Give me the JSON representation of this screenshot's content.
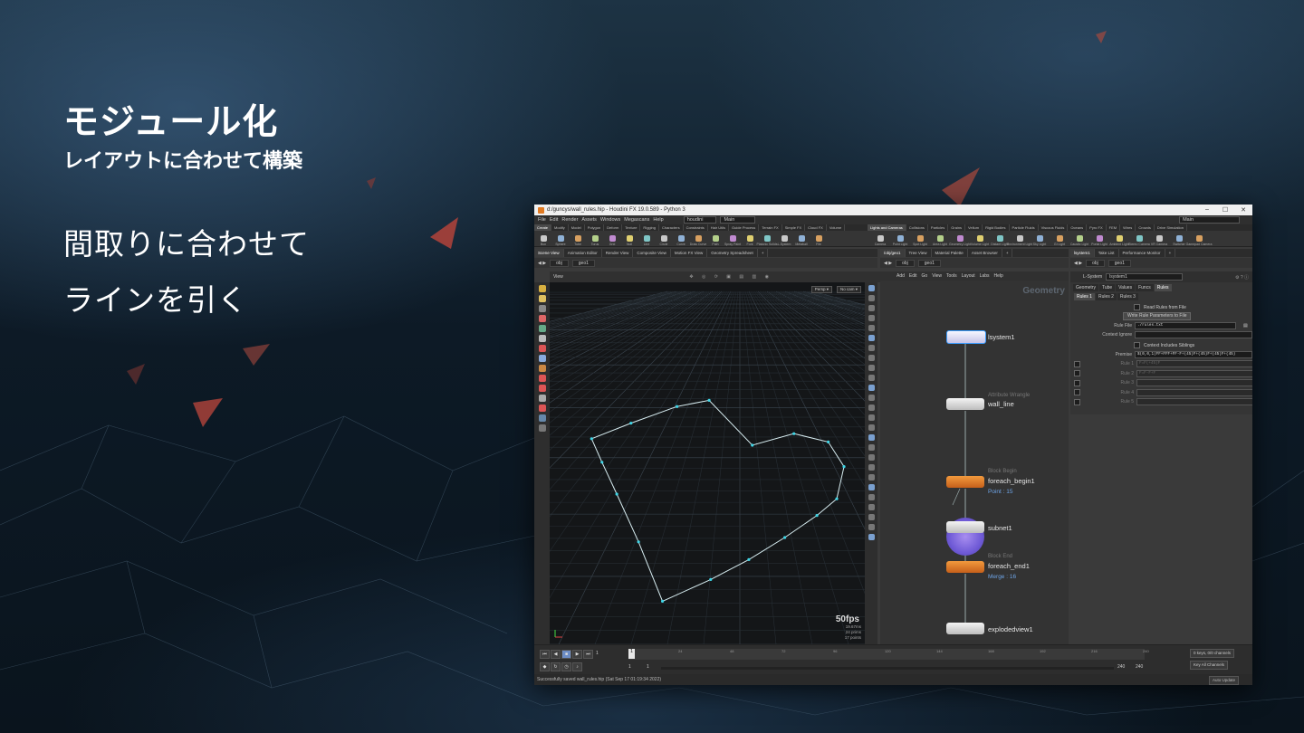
{
  "slide": {
    "title": "モジュール化",
    "subtitle": "レイアウトに合わせて構築",
    "body_line1": "間取りに合わせて",
    "body_line2": "ラインを引く"
  },
  "window": {
    "title": "d:/guncys/wall_rules.hip - Houdini FX 19.0.589 - Python 3",
    "controls": [
      "–",
      "☐",
      "✕"
    ]
  },
  "menu": {
    "items": [
      "File",
      "Edit",
      "Render",
      "Assets",
      "Windows",
      "Megascans",
      "Help"
    ],
    "desktop": "houdini",
    "main": "Main",
    "desktop_right": "Main"
  },
  "shelf_tabs_left": [
    "Create",
    "Modify",
    "Model",
    "Polygon",
    "Deform",
    "Texture",
    "Rigging",
    "Characters",
    "Constraints",
    "Hair Utils",
    "Guide Process",
    "Terrain FX",
    "Simple FX",
    "Cloud FX",
    "Volume"
  ],
  "shelf_tabs_right": [
    "Lights and Cameras",
    "Collisions",
    "Particles",
    "Grains",
    "Vellum",
    "Rigid Bodies",
    "Particle Fluids",
    "Viscous Fluids",
    "Oceans",
    "Pyro FX",
    "FEM",
    "Wires",
    "Crowds",
    "Drive Simulation"
  ],
  "shelf_tools_left": [
    "Box",
    "Sphere",
    "Tube",
    "Torus",
    "Grid",
    "Null",
    "Line",
    "Circle",
    "Curve",
    "Draw Curve",
    "Path",
    "Spray Paint",
    "Font",
    "Platonic Solids",
    "L-System",
    "Metaball",
    "File"
  ],
  "shelf_tools_right": [
    "Camera",
    "Point Light",
    "Spot Light",
    "Area Light",
    "Geometry Light",
    "Volume Light",
    "Distant Light",
    "Environment Light",
    "Sky Light",
    "GI Light",
    "Caustic Light",
    "Portal Light",
    "Ambient Light",
    "Stereo Camera",
    "VR Camera",
    "Switcher",
    "Gamepad Camera"
  ],
  "pane_tabs_left": [
    "Scene View",
    "Animation Editor",
    "Render View",
    "Composite View",
    "Motion FX View",
    "Geometry Spreadsheet"
  ],
  "pane_tabs_mid": [
    "/obj/geo1",
    "Tree View",
    "Material Palette",
    "Asset Browser"
  ],
  "pane_tabs_right": [
    "lsystem1",
    "Take List",
    "Performance Monitor"
  ],
  "path": {
    "obj": "obj",
    "geo": "geo1"
  },
  "viewport": {
    "header": "View",
    "persp": "Persp ▾",
    "no_cam": "No cam ▾",
    "fps": "50fps",
    "stats": [
      "19.67ms",
      "24 prims",
      "17 points"
    ],
    "polyline_points": [
      [
        0.133,
        0.432
      ],
      [
        0.258,
        0.389
      ],
      [
        0.404,
        0.343
      ],
      [
        0.506,
        0.326
      ],
      [
        0.643,
        0.45
      ],
      [
        0.775,
        0.418
      ],
      [
        0.884,
        0.441
      ],
      [
        0.934,
        0.509
      ],
      [
        0.911,
        0.598
      ],
      [
        0.848,
        0.644
      ],
      [
        0.746,
        0.705
      ],
      [
        0.632,
        0.766
      ],
      [
        0.511,
        0.821
      ],
      [
        0.358,
        0.881
      ],
      [
        0.282,
        0.717
      ],
      [
        0.213,
        0.585
      ],
      [
        0.166,
        0.497
      ]
    ]
  },
  "network": {
    "menu": [
      "Add",
      "Edit",
      "Go",
      "View",
      "Tools",
      "Layout",
      "Labs",
      "Help"
    ],
    "context_label": "Geometry",
    "nodes": {
      "lsystem": {
        "name": "lsystem1"
      },
      "wrangle": {
        "type": "Attribute Wrangle",
        "name": "wall_line"
      },
      "begin": {
        "type": "Block Begin",
        "name": "foreach_begin1",
        "info": "Point : 15"
      },
      "subnet": {
        "name": "subnet1"
      },
      "end": {
        "type": "Block End",
        "name": "foreach_end1",
        "info": "Merge : 16"
      },
      "exploded": {
        "name": "explodedview1"
      }
    }
  },
  "params": {
    "node_type": "L-System",
    "node_name": "lsystem1",
    "tabs": [
      "Geometry",
      "Tube",
      "Values",
      "Funcs",
      "Rules"
    ],
    "subtabs": [
      "Rules 1",
      "Rules 2",
      "Rules 3"
    ],
    "read_rules": "Read Rules from File",
    "write_rules": "Write Rule Parameters to File",
    "rule_file_label": "Rule File",
    "rule_file_value": "./rules.txt",
    "context_ignore_label": "Context Ignore",
    "context_siblings": "Context Includes Siblings",
    "premise_label": "Premise",
    "premise_value": "$(0,0,1)FF+FFF+FF-F+(45)F+(45)F+(45)F+(45)",
    "rules": [
      "Rule 1",
      "Rule 2",
      "Rule 3",
      "Rule 4",
      "Rule 5"
    ],
    "rule1_value": "F=F(+45)F",
    "rule2_value": "F=F-F+F"
  },
  "timeline": {
    "frame": "1",
    "ticks": [
      "24",
      "48",
      "72",
      "96",
      "120",
      "144",
      "168",
      "192",
      "216",
      "240"
    ],
    "start": "1",
    "start2": "1",
    "end": "240",
    "end2": "240",
    "keys": "0 keys, 0/0 channels",
    "key_all": "Key All Channels",
    "auto_update": "Auto Update"
  },
  "status": "Successfully saved wall_rules.hip (Sat Sep 17 01:19:34 2022)",
  "colors": {
    "accent": "#e07a22",
    "point": "#3fd5e6",
    "line": "#d8eef2",
    "node_orange": "#e8862f",
    "lsystem_purple": "#7b66e0"
  }
}
